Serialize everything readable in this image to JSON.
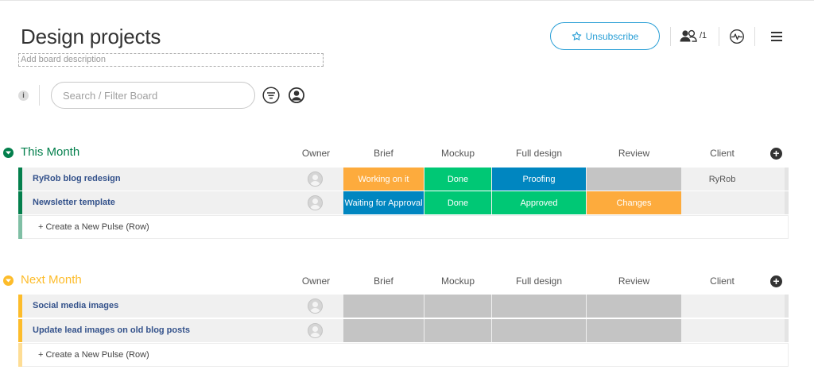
{
  "board": {
    "title": "Design projects",
    "description_placeholder": "Add board description",
    "unsubscribe_label": "Unsubscribe",
    "members_count": "/1",
    "search_placeholder": "Search / Filter Board",
    "info_label": "i"
  },
  "columns": [
    "Owner",
    "Brief",
    "Mockup",
    "Full design",
    "Review",
    "Client"
  ],
  "colors": {
    "green_group": "#037f4c",
    "yellow_group": "#fdbc2a",
    "orange": "#fdab3d",
    "green": "#00c875",
    "blue": "#0086c0",
    "gray": "#c4c4c4"
  },
  "groups": [
    {
      "title": "This Month",
      "create_label": "+ Create a New Pulse (Row)",
      "rows": [
        {
          "name": "RyRob blog redesign",
          "brief": "Working on it",
          "mockup": "Done",
          "full_design": "Proofing",
          "review": "",
          "client": "RyRob"
        },
        {
          "name": "Newsletter template",
          "brief": "Waiting for Approval",
          "mockup": "Done",
          "full_design": "Approved",
          "review": "Changes",
          "client": ""
        }
      ]
    },
    {
      "title": "Next Month",
      "create_label": "+ Create a New Pulse (Row)",
      "rows": [
        {
          "name": "Social media images",
          "brief": "",
          "mockup": "",
          "full_design": "",
          "review": "",
          "client": ""
        },
        {
          "name": "Update lead images on old blog posts",
          "brief": "",
          "mockup": "",
          "full_design": "",
          "review": "",
          "client": ""
        }
      ]
    }
  ],
  "icons": {
    "unsubscribe": "star-outline-icon",
    "members": "people-icon",
    "activity": "activity-icon",
    "menu": "hamburger-menu-icon",
    "filter": "filter-icon",
    "person": "person-icon",
    "group_toggle": "chevron-down-icon",
    "add_column": "plus-icon"
  }
}
